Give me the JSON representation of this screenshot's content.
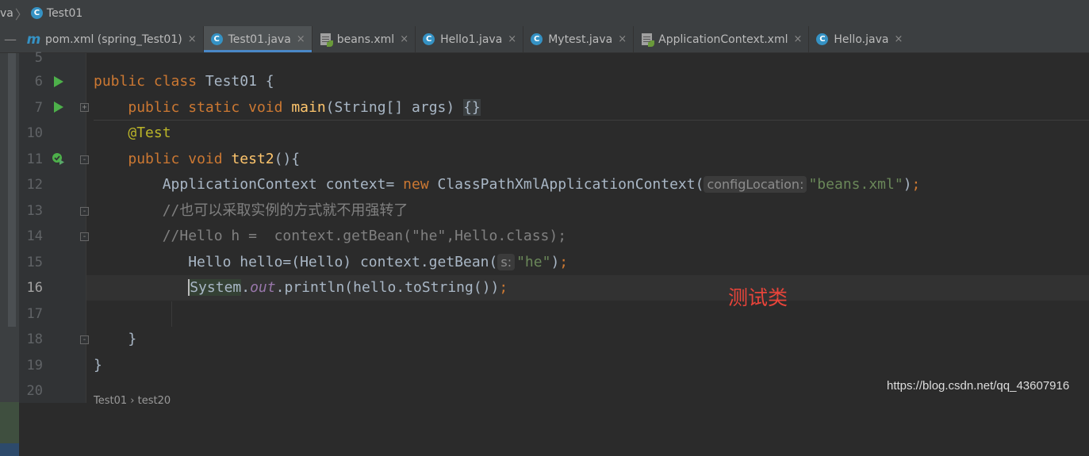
{
  "breadcrumb": {
    "items": [
      "va",
      "Test01"
    ]
  },
  "tabs": [
    {
      "label": "pom.xml (spring_Test01)",
      "icon": "maven-icon",
      "active": false
    },
    {
      "label": "Test01.java",
      "icon": "java-class-icon",
      "active": true
    },
    {
      "label": "beans.xml",
      "icon": "spring-xml-icon",
      "active": false
    },
    {
      "label": "Hello1.java",
      "icon": "java-class-icon",
      "active": false
    },
    {
      "label": "Mytest.java",
      "icon": "java-class-icon",
      "active": false
    },
    {
      "label": "ApplicationContext.xml",
      "icon": "spring-xml-icon",
      "active": false
    },
    {
      "label": "Hello.java",
      "icon": "java-class-icon",
      "active": false
    }
  ],
  "close_glyph": "×",
  "line_numbers": [
    "5",
    "6",
    "7",
    "10",
    "11",
    "12",
    "13",
    "14",
    "15",
    "16",
    "17",
    "18",
    "19",
    "20"
  ],
  "code": {
    "l6": {
      "kw1": "public",
      "kw2": "class",
      "rest": " Test01 {"
    },
    "l7": {
      "kw1": "public",
      "kw2": "static",
      "kw3": "void",
      "fn": "main",
      "rest": "(String[] args) ",
      "fold": "{}"
    },
    "l10": {
      "ann": "@Test"
    },
    "l11": {
      "kw1": "public",
      "kw2": "void",
      "fn": "test2",
      "rest": "(){"
    },
    "l12": {
      "pre": "ApplicationContext context= ",
      "kw": "new",
      "mid": " ClassPathXmlApplicationContext(",
      "hint": "configLocation:",
      "str": "\"beans.xml\"",
      "end": ")",
      "semi": ";"
    },
    "l13": {
      "cmt": "//也可以采取实例的方式就不用强转了"
    },
    "l14": {
      "cmt": "//Hello h =  context.getBean(\"he\",Hello.class);"
    },
    "l15": {
      "pre": "Hello hello=(Hello) context.getBean(",
      "hint": "s:",
      "str": "\"he\"",
      "end": ")",
      "semi": ";"
    },
    "l16": {
      "cls": "System",
      "dot": ".",
      "fld": "out",
      "rest": ".println(hello.toString())",
      "semi": ";"
    },
    "l18": {
      "rest": "}"
    },
    "l19": {
      "rest": "}"
    }
  },
  "annotation_text": "测试类",
  "watermark": "https://blog.csdn.net/qq_43607916",
  "bottom_crumb": "Test01 › test20"
}
